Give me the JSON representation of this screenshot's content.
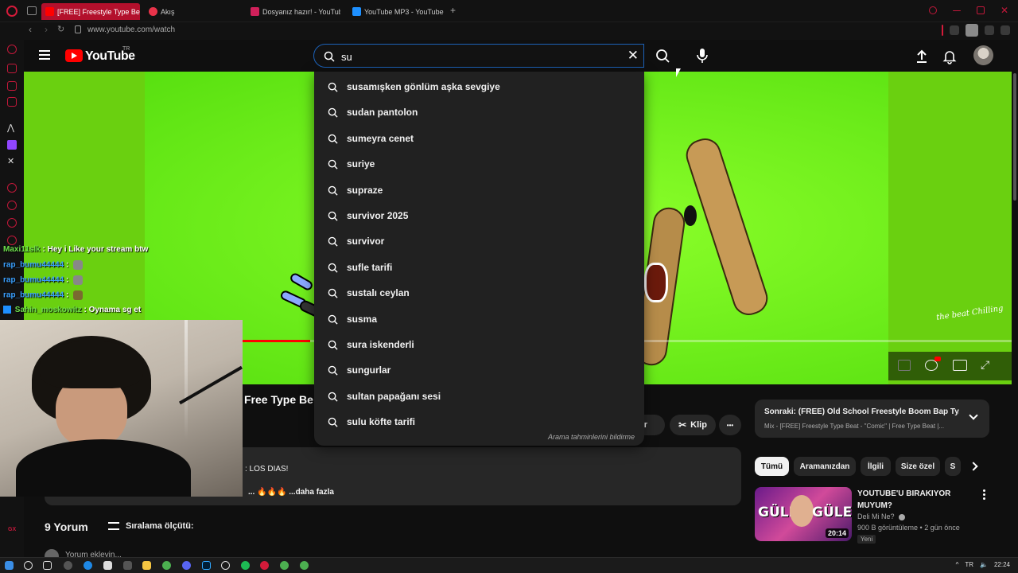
{
  "browser": {
    "tabs": [
      {
        "label": "[FREE] Freestyle Type Be",
        "active": true,
        "favicon_color": "#ff0000"
      },
      {
        "label": "Akış",
        "active": false,
        "favicon_color": "#e8334a"
      },
      {
        "label": "Dosyanız hazır! - YouTub",
        "active": false,
        "favicon_color": "#d0205a"
      },
      {
        "label": "YouTube MP3 - YouTube",
        "active": false,
        "favicon_color": "#1e90ff"
      }
    ],
    "new_tab": "+",
    "url": "www.youtube.com/watch"
  },
  "youtube": {
    "wordmark": "YouTube",
    "country": "TR",
    "search": {
      "value": "su",
      "placeholder": "Ara",
      "clear": "✕"
    },
    "suggestions": [
      "susamışken gönlüm aşka sevgiye",
      "sudan pantolon",
      "sumeyra cenet",
      "suriye",
      "supraze",
      "survivor 2025",
      "survivor",
      "sufle tarifi",
      "sustalı ceylan",
      "susma",
      "sura iskenderli",
      "sungurlar",
      "sultan papağanı sesi",
      "sulu köfte tarifi"
    ],
    "suggestions_report": "Arama tahminlerini bildirme",
    "player": {
      "progress": 0.29,
      "watermark": "the beat Chilling"
    },
    "video": {
      "title_visible": "Free Type Be",
      "actions": {
        "download_partial": "dir",
        "clip": "Klip",
        "more": "•••"
      },
      "description_line1": ": LOS DIAS!",
      "description_line2": "... 🔥🔥🔥 ...daha fazla"
    },
    "comments": {
      "count": "9 Yorum",
      "sort": "Sıralama ölçütü:",
      "add_placeholder": "Yorum ekleyin..."
    },
    "next_up": {
      "title": "Sonraki: (FREE) Old School Freestyle Boom Bap Ty...",
      "subtitle": "Mix - [FREE] Freestyle Type Beat - \"Comic\" | Free Type Beat |..."
    },
    "chips": [
      "Tümü",
      "Aramanızdan",
      "İlgili",
      "Size özel",
      "S"
    ],
    "recommendation": {
      "thumb_word_left": "GÜLE",
      "thumb_word_right": "GÜLE",
      "duration": "20:14",
      "title": "YOUTUBE'U BIRAKIYOR MUYUM?",
      "channel": "Deli Mi Ne?",
      "meta": "900 B görüntüleme • 2 gün önce",
      "badge": "Yeni"
    }
  },
  "stream_chat": [
    {
      "user": "Maxi11slk",
      "color": "#6ee04c",
      "msg": ": Hey i Like your stream btw",
      "emote": false
    },
    {
      "user": "rap_bumu44444",
      "color": "#3aa0ff",
      "msg": ":",
      "emote": true
    },
    {
      "user": "rap_bumu44444",
      "color": "#3aa0ff",
      "msg": ":",
      "emote": true
    },
    {
      "user": "rap_bumu44444",
      "color": "#3aa0ff",
      "msg": ":",
      "emote": true
    },
    {
      "user": "Sahin_moskowitz",
      "color": "#6ee04c",
      "msg": ": Oynama sg et",
      "emote": false
    }
  ],
  "taskbar": {
    "clock": "22:24",
    "lang": "TR",
    "gx": "GX"
  }
}
